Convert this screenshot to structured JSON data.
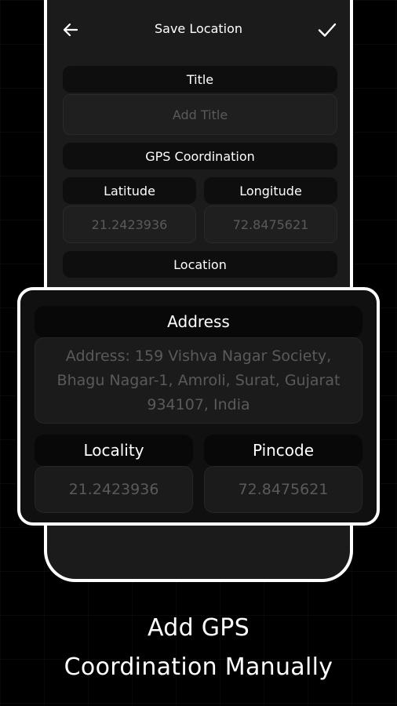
{
  "header": {
    "title": "Save Location"
  },
  "form": {
    "title_label": "Title",
    "title_placeholder": "Add Title",
    "gps_label": "GPS Coordination",
    "latitude_label": "Latitude",
    "latitude_value": "21.2423936",
    "longitude_label": "Longitude",
    "longitude_value": "72.8475621",
    "location_label": "Location"
  },
  "card": {
    "address_label": "Address",
    "address_value": "Address: 159 Vishva Nagar Society, Bhagu Nagar-1, Amroli, Surat, Gujarat 934107, India",
    "locality_label": "Locality",
    "locality_value": "21.2423936",
    "pincode_label": "Pincode",
    "pincode_value": "72.8475621"
  },
  "caption": {
    "line1": "Add GPS",
    "line2": "Coordination Manually"
  },
  "icons": {
    "back": "arrow-left-icon",
    "confirm": "checkmark-icon"
  },
  "colors": {
    "background": "#000000",
    "panel": "#1b1b1b",
    "label_bg": "#0e0e0e",
    "field_text": "#5a5a5a"
  }
}
